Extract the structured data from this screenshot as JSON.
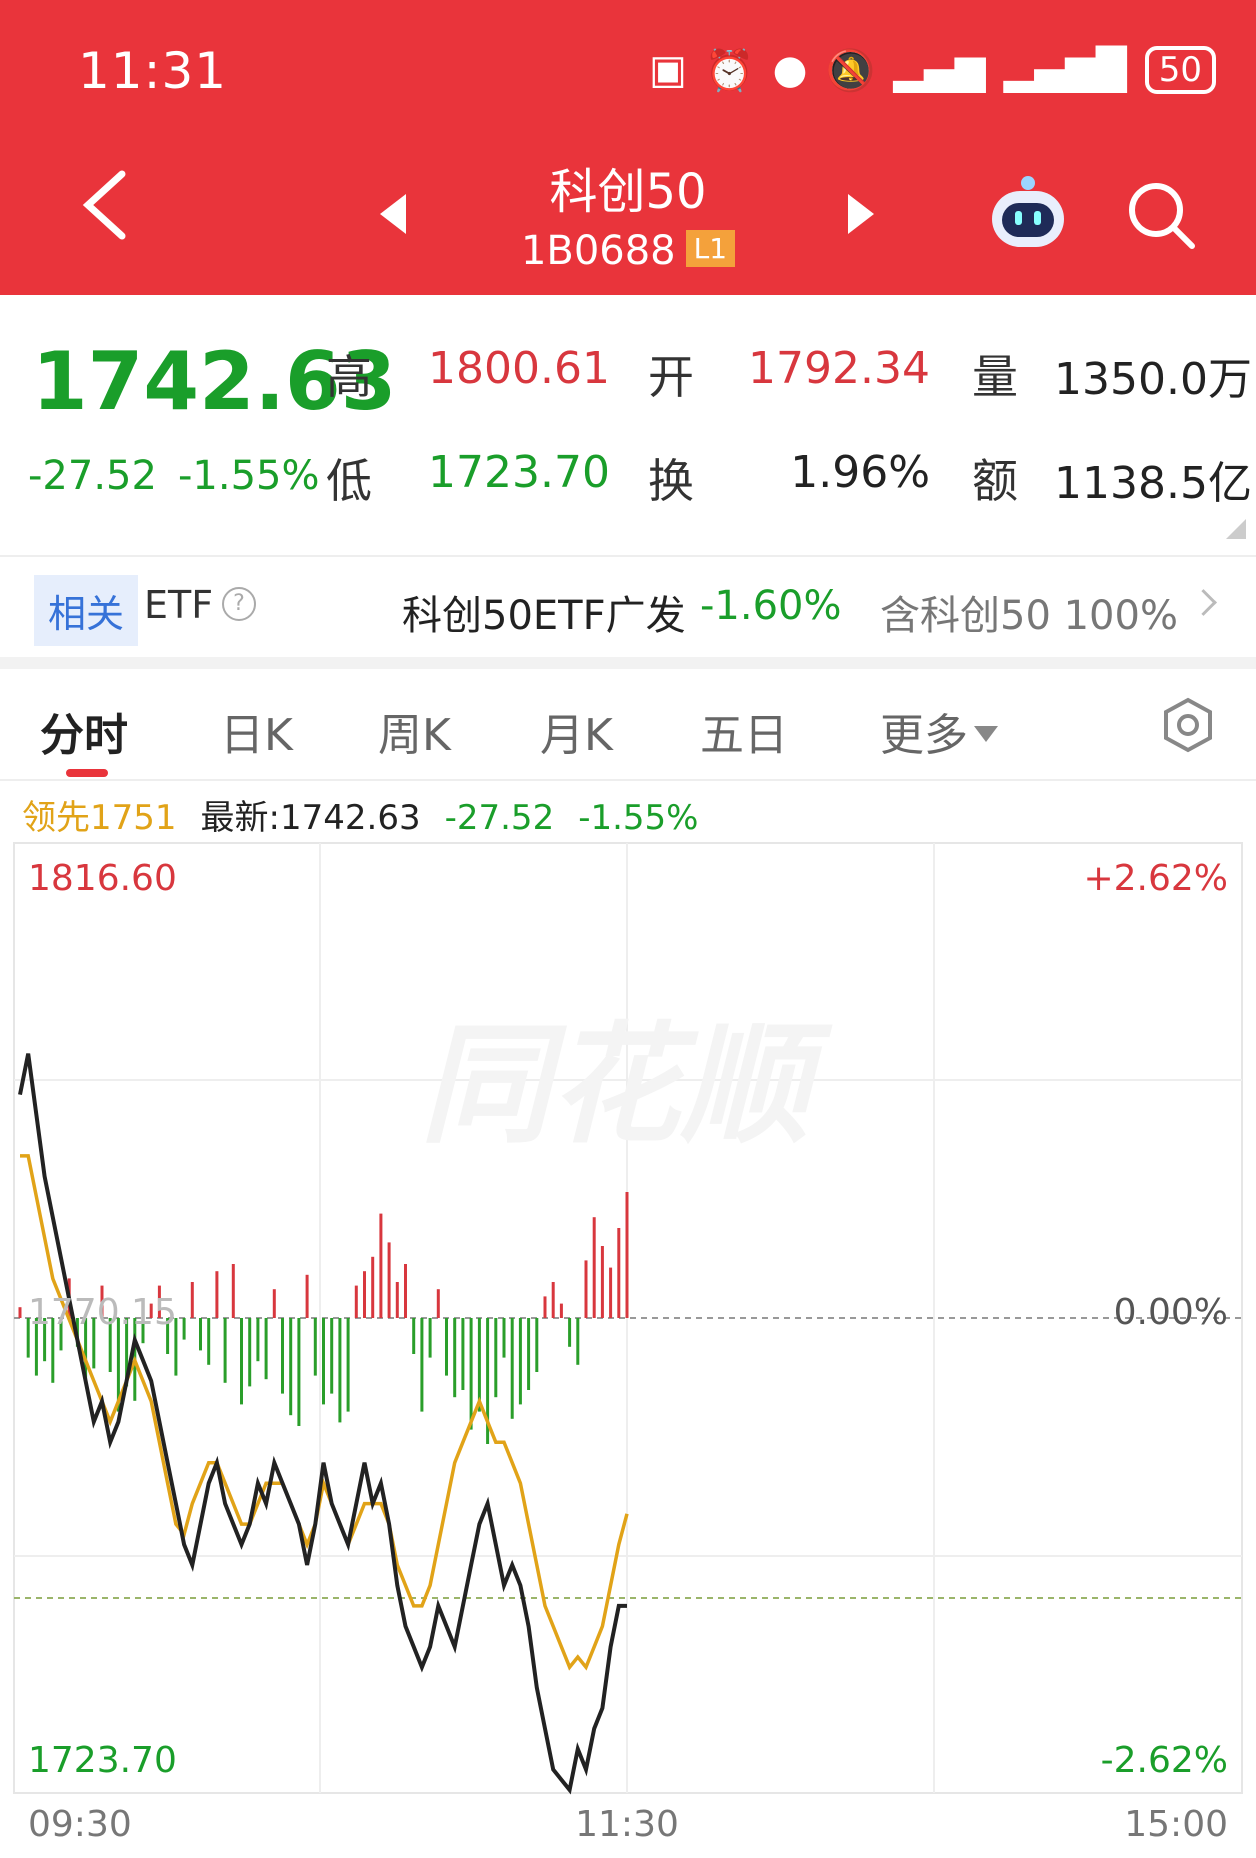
{
  "status_bar": {
    "time": "11:31",
    "battery": "50"
  },
  "header": {
    "title": "科创50",
    "code": "1B0688",
    "level_badge": "L1"
  },
  "quote": {
    "price": "1742.63",
    "change": "-27.52",
    "change_pct": "-1.55%",
    "high_label": "高",
    "high": "1800.61",
    "open_label": "开",
    "open": "1792.34",
    "volume_label": "量",
    "volume": "1350.0万",
    "low_label": "低",
    "low": "1723.70",
    "turnover_label": "换",
    "turnover": "1.96%",
    "amount_label": "额",
    "amount": "1138.5亿"
  },
  "etf": {
    "tag": "相关",
    "word": "ETF",
    "name": "科创50ETF广发",
    "pct": "-1.60%",
    "holding": "含科创50 100%"
  },
  "tabs": [
    {
      "label": "分时"
    },
    {
      "label": "日K"
    },
    {
      "label": "周K"
    },
    {
      "label": "月K"
    },
    {
      "label": "五日"
    },
    {
      "label": "更多"
    }
  ],
  "legend": {
    "lead": "领先1751",
    "latest": "最新:1742.63",
    "change": "-27.52",
    "pct": "-1.55%"
  },
  "watermark": "同花顺",
  "colors": {
    "header": "#e9343b",
    "up": "#d8373e",
    "down": "#1a9e2a",
    "lead_line": "#e1a318",
    "price_line": "#222222"
  },
  "chart_data": {
    "type": "line",
    "y_max": "1816.60",
    "y_min": "1723.70",
    "y_max_pct": "+2.62%",
    "y_min_pct": "-2.62%",
    "baseline": "1770.15",
    "baseline_pct": "0.00%",
    "x_labels": [
      "09:30",
      "11:30",
      "15:00"
    ],
    "ylim": [
      1723.7,
      1816.6
    ],
    "series": [
      {
        "values": [
          1792,
          1796,
          1790,
          1784,
          1780,
          1776,
          1772,
          1768,
          1764,
          1760,
          1762,
          1758,
          1760,
          1764,
          1768,
          1766,
          1764,
          1760,
          1756,
          1752,
          1748,
          1746,
          1750,
          1754,
          1756,
          1752,
          1750,
          1748,
          1750,
          1754,
          1752,
          1756,
          1754,
          1752,
          1750,
          1746,
          1750,
          1756,
          1752,
          1750,
          1748,
          1752,
          1756,
          1752,
          1754,
          1750,
          1744,
          1740,
          1738,
          1736,
          1738,
          1742,
          1740,
          1738,
          1742,
          1746,
          1750,
          1752,
          1748,
          1744,
          1746,
          1744,
          1740,
          1734,
          1730,
          1726,
          1725,
          1724,
          1728,
          1726,
          1730,
          1732,
          1738,
          1742,
          1742
        ]
      },
      {
        "values": [
          1786,
          1786,
          1782,
          1778,
          1774,
          1772,
          1770,
          1768,
          1766,
          1764,
          1762,
          1760,
          1762,
          1764,
          1766,
          1764,
          1762,
          1758,
          1754,
          1750,
          1749,
          1752,
          1754,
          1756,
          1756,
          1754,
          1752,
          1750,
          1750,
          1752,
          1754,
          1754,
          1754,
          1752,
          1750,
          1748,
          1750,
          1754,
          1752,
          1750,
          1748,
          1750,
          1752,
          1752,
          1752,
          1750,
          1746,
          1744,
          1742,
          1742,
          1744,
          1748,
          1752,
          1756,
          1758,
          1760,
          1762,
          1760,
          1758,
          1758,
          1756,
          1754,
          1750,
          1746,
          1742,
          1740,
          1738,
          1736,
          1737,
          1736,
          1738,
          1740,
          1744,
          1748,
          1751
        ]
      }
    ],
    "volume_bars": [
      0.3,
      -1.1,
      -1.6,
      -1.2,
      -1.8,
      -0.9,
      1.1,
      -0.8,
      -1.7,
      -1.4,
      0.9,
      -1.5,
      -2.6,
      -1.9,
      -2.3,
      -0.7,
      0.4,
      0.9,
      -1.0,
      -1.6,
      -0.6,
      1.0,
      -0.9,
      -1.3,
      1.3,
      -1.8,
      1.5,
      -2.4,
      -1.9,
      -1.2,
      -1.7,
      0.8,
      -2.1,
      -2.7,
      -3.0,
      1.2,
      -1.6,
      -2.4,
      -2.1,
      -2.9,
      -2.6,
      0.9,
      1.3,
      1.7,
      2.9,
      2.1,
      1.0,
      1.5,
      -1.0,
      -2.6,
      -1.1,
      0.8,
      -1.6,
      -2.2,
      -2.0,
      -3.1,
      -2.6,
      -3.5,
      -2.2,
      -1.1,
      -2.8,
      -2.4,
      -2.0,
      -1.5,
      0.6,
      1.0,
      0.4,
      -0.8,
      -1.3,
      1.6,
      2.8,
      2.0,
      1.4,
      2.5,
      3.5
    ]
  }
}
